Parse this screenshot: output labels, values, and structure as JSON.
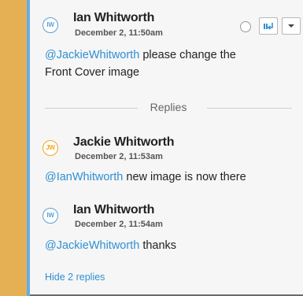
{
  "comments": [
    {
      "initials": "IW",
      "author": "Ian Whitworth",
      "date": "December 2, 11:50am",
      "mention": "@JackieWhitworth",
      "text_line1": "please change the",
      "text_line2": "Front Cover image"
    },
    {
      "initials": "JW",
      "author": "Jackie Whitworth",
      "date": "December 2, 11:53am",
      "mention": "@IanWhitworth",
      "text": "new image is now there"
    },
    {
      "initials": "IW",
      "author": "Ian Whitworth",
      "date": "December 2, 11:54am",
      "mention": "@JackieWhitworth",
      "text": "thanks"
    }
  ],
  "replies_label": "Replies",
  "hide_replies_label": "Hide 2 replies",
  "colors": {
    "accent_blue": "#2f8fd3",
    "avatar_blue": "#5a9fd6",
    "avatar_orange": "#f0a524",
    "background_orange": "#e4b053"
  },
  "icons": {
    "assign": "assign-arrow-icon",
    "menu": "chevron-down-icon",
    "resolve": "radio-circle-icon"
  }
}
